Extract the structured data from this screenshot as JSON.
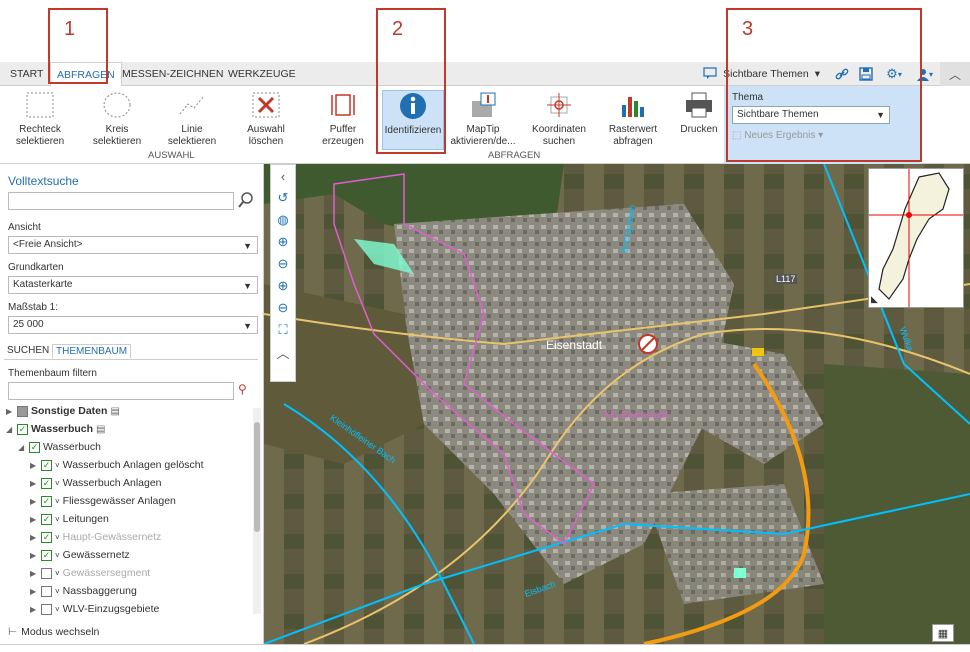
{
  "tabs": [
    "START",
    "ABFRAGEN",
    "MESSEN-ZEICHNEN",
    "WERKZEUGE"
  ],
  "themen_button": "Sichtbare Themen",
  "ribbon": {
    "buttons": [
      {
        "label": "Rechteck\nselektieren",
        "icon": "rectangle-select-icon"
      },
      {
        "label": "Kreis\nselektieren",
        "icon": "circle-select-icon"
      },
      {
        "label": "Linie\nselektieren",
        "icon": "line-select-icon"
      },
      {
        "label": "Auswahl\nlöschen",
        "icon": "clear-selection-icon"
      },
      {
        "label": "Puffer\nerzeugen",
        "icon": "buffer-icon"
      },
      {
        "label": "Identifizieren",
        "icon": "info-icon"
      },
      {
        "label": "MapTip\naktivieren/de...",
        "icon": "maptip-icon"
      },
      {
        "label": "Koordinaten\nsuchen",
        "icon": "coordinates-icon"
      },
      {
        "label": "Rasterwert\nabfragen",
        "icon": "raster-chart-icon"
      },
      {
        "label": "Drucken",
        "icon": "printer-icon"
      }
    ],
    "group_auswahl": "AUSWAHL",
    "group_abfragen": "ABFRAGEN",
    "thema": {
      "title": "Thema",
      "value": "Sichtbare Themen",
      "neues_ergebnis": "Neues Ergebnis"
    }
  },
  "annotations": [
    "1",
    "2",
    "3"
  ],
  "left": {
    "volltext_title": "Volltextsuche",
    "volltext_value": "",
    "ansicht_label": "Ansicht",
    "ansicht_value": "<Freie Ansicht>",
    "grundkarten_label": "Grundkarten",
    "grundkarten_value": "Katasterkarte",
    "massstab_label": "Maßstab 1:",
    "massstab_value": "25 000",
    "subtabs": [
      "SUCHEN",
      "THEMENBAUM"
    ],
    "filter_label": "Themenbaum filtern",
    "filter_value": "",
    "tree": [
      {
        "label": "Sonstige Daten",
        "level": 0,
        "twist": "▶",
        "check": "gray",
        "bold": true,
        "faded": false
      },
      {
        "label": "Wasserbuch",
        "level": 0,
        "twist": "◢",
        "check": "checked",
        "bold": true,
        "faded": false
      },
      {
        "label": "Wasserbuch",
        "level": 1,
        "twist": "◢",
        "check": "checked",
        "bold": false,
        "faded": false
      },
      {
        "label": "Wasserbuch Anlagen gelöscht",
        "level": 2,
        "twist": "▶",
        "check": "checked",
        "bold": false,
        "faded": false
      },
      {
        "label": "Wasserbuch Anlagen",
        "level": 2,
        "twist": "▶",
        "check": "checked",
        "bold": false,
        "faded": false
      },
      {
        "label": "Fliessgewässer Anlagen",
        "level": 2,
        "twist": "▶",
        "check": "checked",
        "bold": false,
        "faded": false
      },
      {
        "label": "Leitungen",
        "level": 2,
        "twist": "▶",
        "check": "checked",
        "bold": false,
        "faded": false
      },
      {
        "label": "Haupt-Gewässernetz",
        "level": 2,
        "twist": "▶",
        "check": "checked",
        "bold": false,
        "faded": true
      },
      {
        "label": "Gewässernetz",
        "level": 2,
        "twist": "▶",
        "check": "checked",
        "bold": false,
        "faded": false
      },
      {
        "label": "Gewässersegment",
        "level": 2,
        "twist": "▶",
        "check": "empty",
        "bold": false,
        "faded": true
      },
      {
        "label": "Nassbaggerung",
        "level": 2,
        "twist": "▶",
        "check": "empty",
        "bold": false,
        "faded": false
      },
      {
        "label": "WLV-Einzugsgebiete",
        "level": 2,
        "twist": "▶",
        "check": "empty",
        "bold": false,
        "faded": false
      }
    ],
    "modus": "Modus wechseln"
  },
  "map": {
    "labels": {
      "city": "Eisenstadt",
      "kg": "KG Eisenstadt",
      "road": "L117",
      "kleinhoeflein": "Kleinhöfleiner Bach",
      "eisbach": "Eisbach",
      "buchgraben": "Buchgraben",
      "wulka": "Wulka"
    }
  },
  "colors": {
    "accent": "#1f6fb2",
    "annotation": "#c0392b",
    "selected": "#cde2f7"
  }
}
